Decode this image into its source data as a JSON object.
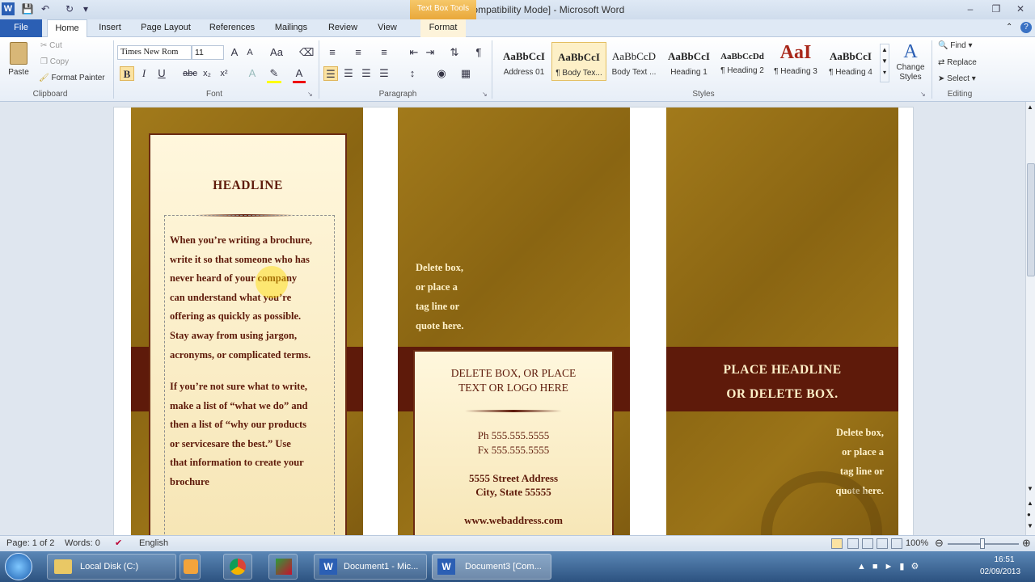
{
  "window": {
    "title": "Document3 [Compatibility Mode]  -  Microsoft Word",
    "contextual_tab_group": "Text Box Tools",
    "app_icon": "W"
  },
  "tabs": [
    "File",
    "Home",
    "Insert",
    "Page Layout",
    "References",
    "Mailings",
    "Review",
    "View",
    "Format"
  ],
  "ribbon": {
    "clipboard": {
      "paste": "Paste",
      "cut": "Cut",
      "copy": "Copy",
      "format_painter": "Format Painter",
      "label": "Clipboard"
    },
    "font": {
      "name": "Times New Rom",
      "size": "11",
      "label": "Font"
    },
    "paragraph": {
      "label": "Paragraph"
    },
    "styles": {
      "label": "Styles",
      "items": [
        {
          "sample": "AaBbCcI",
          "name": "Address 01"
        },
        {
          "sample": "AaBbCcI",
          "name": "¶ Body Tex..."
        },
        {
          "sample": "AaBbCcD",
          "name": "Body Text ..."
        },
        {
          "sample": "AaBbCcI",
          "name": "Heading 1"
        },
        {
          "sample": "AaBbCcDd",
          "name": "¶ Heading 2"
        },
        {
          "sample": "AaI",
          "name": "¶ Heading 3"
        },
        {
          "sample": "AaBbCcI",
          "name": "¶ Heading 4"
        }
      ],
      "change_styles": "Change Styles"
    },
    "editing": {
      "find": "Find",
      "replace": "Replace",
      "select": "Select",
      "label": "Editing"
    }
  },
  "document": {
    "left_panel": {
      "headline": "HEADLINE",
      "para1": [
        "When you’re writing a brochure,",
        "write it so that someone who has",
        "never heard of your company",
        "can understand what you’re",
        "offering as quickly as possible.",
        "Stay away  from using jargon,",
        "acronyms, or complicated terms."
      ],
      "para2": [
        "If you’re not sure what to write,",
        "make a list of “what we do” and",
        "then a list of “why our products",
        "or servicesare the best.” Use",
        "that information to create your",
        "brochure"
      ]
    },
    "middle_panel": {
      "quote": [
        "Delete box,",
        "or place a",
        "tag line or",
        "quote here."
      ],
      "box_title": [
        "DELETE BOX, OR PLACE",
        "TEXT  OR LOGO HERE"
      ],
      "phone": "Ph 555.555.5555",
      "fax": "Fx 555.555.5555",
      "address1": "5555 Street Address",
      "address2": "City, State 55555",
      "web": "www.webaddress.com"
    },
    "right_panel": {
      "headline": [
        "PLACE HEADLINE",
        "OR DELETE BOX."
      ],
      "quote": [
        "Delete box,",
        "or place a",
        "tag line or",
        "quote here."
      ]
    }
  },
  "status": {
    "page": "Page: 1 of 2",
    "words": "Words: 0",
    "language": "English",
    "zoom": "100%"
  },
  "taskbar": {
    "items": [
      "Local Disk (C:)",
      "Document1 - Mic...",
      "Document3 [Com..."
    ],
    "time": "16:51",
    "date": "02/09/2013"
  },
  "colors": {
    "maroon": "#5e1a0a",
    "gold": "#9b7418",
    "cream": "#fff7dd",
    "file_tab": "#2b5fb4",
    "contextual": "#e9a83a"
  }
}
